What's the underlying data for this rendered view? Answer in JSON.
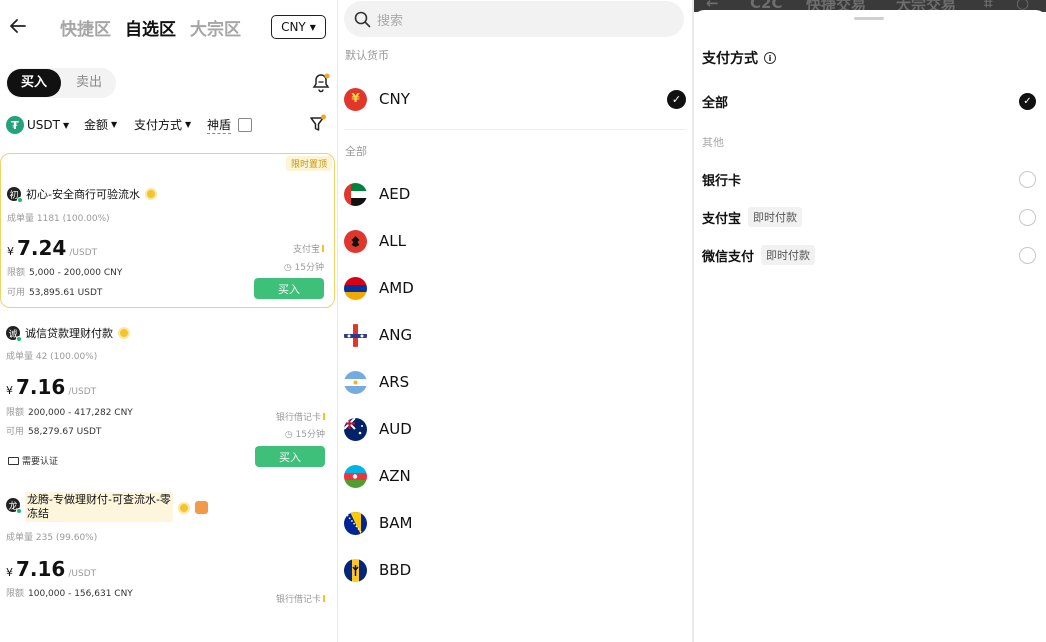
{
  "market": {
    "tabs": [
      "快捷区",
      "自选区",
      "大宗区"
    ],
    "active_tab": 1,
    "currency_button": "CNY",
    "buy_label": "买入",
    "sell_label": "卖出",
    "filters": {
      "coin": "USDT",
      "amount": "金额",
      "payment": "支付方式",
      "shield": "神盾"
    },
    "ads": [
      {
        "badge": "限时置顶",
        "merchant": "初心-安全商行可验流水",
        "avatar_char": "初",
        "volume": "成单量 1181 (100.00%)",
        "currency_symbol": "¥",
        "price": "7.24",
        "unit": "/USDT",
        "limit_label": "限额",
        "limit": "5,000 - 200,000 CNY",
        "avail_label": "可用",
        "avail": "53,895.61 USDT",
        "payment": "支付宝",
        "time": "15分钟",
        "buy": "买入"
      },
      {
        "merchant": "诚信贷款理财付款",
        "avatar_char": "诚",
        "volume": "成单量 42 (100.00%)",
        "currency_symbol": "¥",
        "price": "7.16",
        "unit": "/USDT",
        "limit_label": "限额",
        "limit": "200,000 - 417,282 CNY",
        "avail_label": "可用",
        "avail": "58,279.67 USDT",
        "payment": "银行借记卡",
        "time": "15分钟",
        "verify": "需要认证",
        "buy": "买入"
      },
      {
        "merchant": "龙腾-专做理财付-可查流水-零冻结",
        "merchant_line1": "龙腾-专做理财付-可查流水-零",
        "merchant_line2": "冻结",
        "avatar_char": "龙",
        "volume": "成单量 235 (99.60%)",
        "currency_symbol": "¥",
        "price": "7.16",
        "unit": "/USDT",
        "limit_label": "限额",
        "limit": "100,000 - 156,631 CNY",
        "payment": "银行借记卡"
      }
    ]
  },
  "currency_picker": {
    "search_placeholder": "搜索",
    "default_label": "默认货币",
    "default_currency": "CNY",
    "all_label": "全部",
    "currencies": [
      "AED",
      "ALL",
      "AMD",
      "ANG",
      "ARS",
      "AUD",
      "AZN",
      "BAM",
      "BBD"
    ]
  },
  "payment_sheet": {
    "bg_tabs": [
      "C2C",
      "快捷交易",
      "大宗交易"
    ],
    "title": "支付方式",
    "all_option": "全部",
    "other_label": "其他",
    "options": [
      {
        "label": "银行卡",
        "tag": ""
      },
      {
        "label": "支付宝",
        "tag": "即时付款"
      },
      {
        "label": "微信支付",
        "tag": "即时付款"
      }
    ]
  },
  "colors": {
    "buy_green": "#3ec07a",
    "featured_border": "#f0d265",
    "tether": "#26a17b"
  }
}
